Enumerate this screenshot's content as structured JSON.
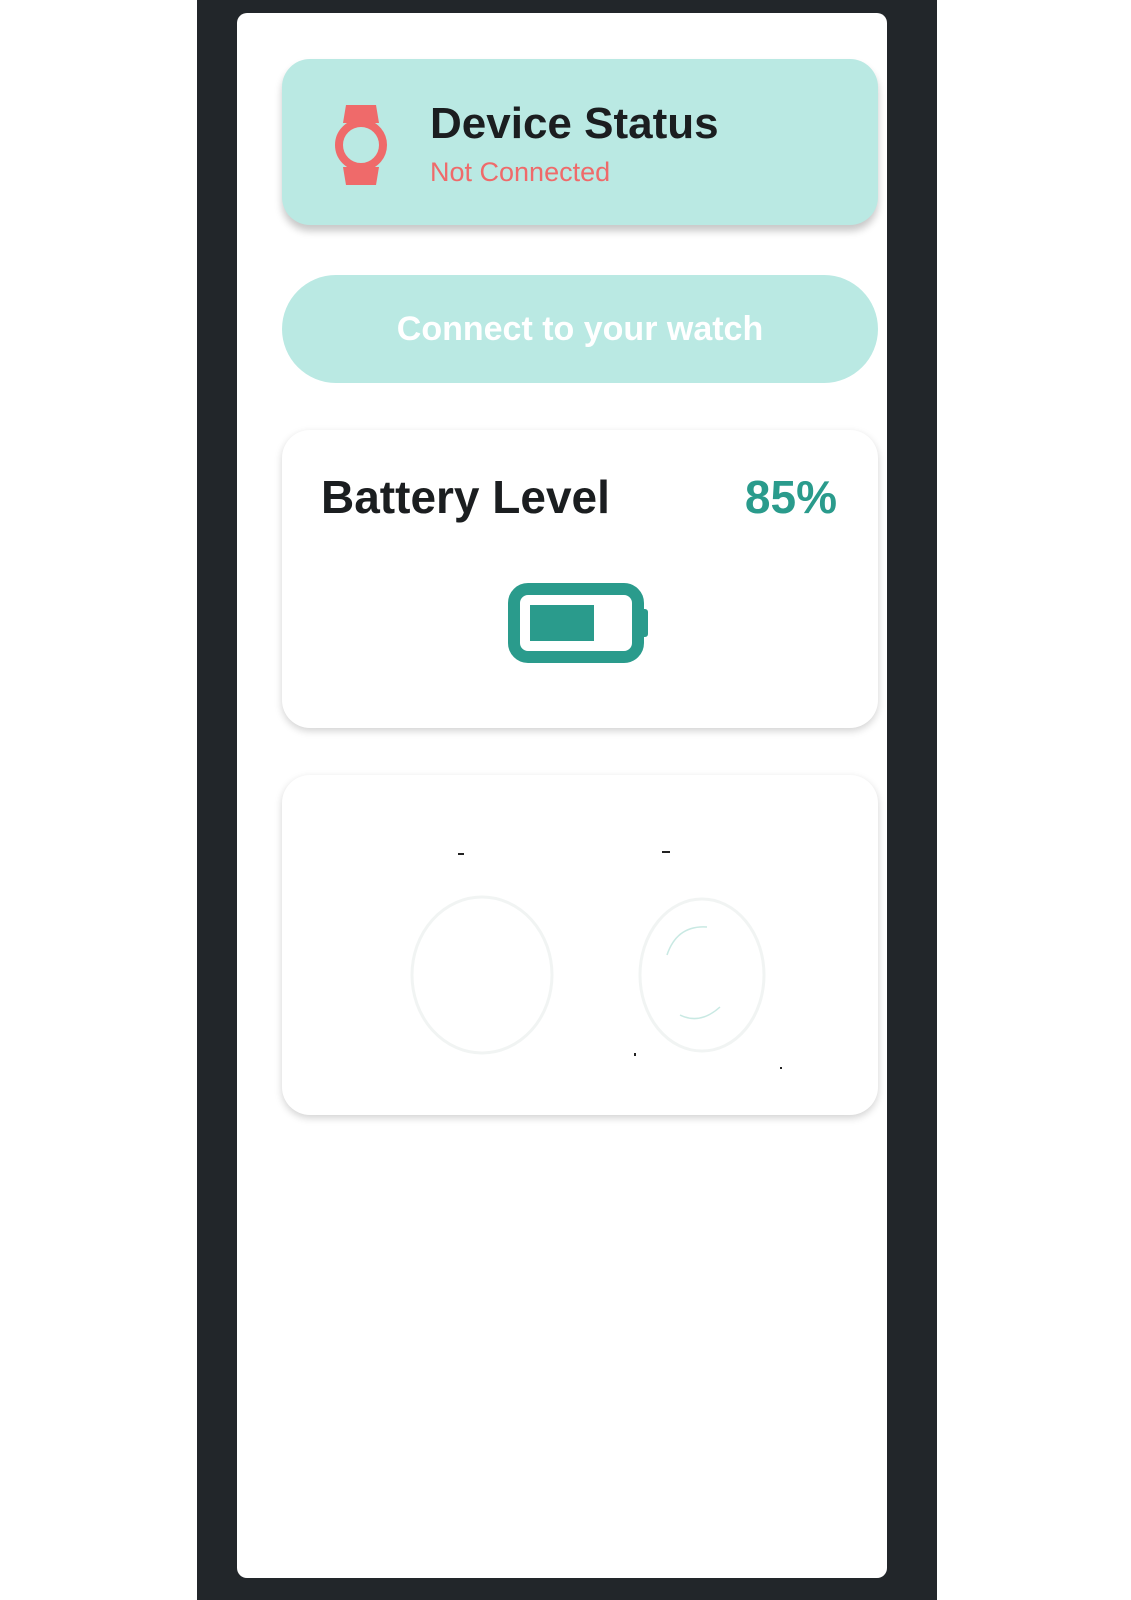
{
  "device_status": {
    "title": "Device Status",
    "status": "Not Connected",
    "icon": "watch-icon"
  },
  "connect_button": {
    "label": "Connect to your watch"
  },
  "battery": {
    "title": "Battery Level",
    "value": "85%",
    "level_percent": 85,
    "icon": "battery-icon"
  },
  "colors": {
    "card_bg": "#bae9e3",
    "accent": "#2a9b8c",
    "status_red": "#ef6a6a",
    "frame": "#22262a"
  }
}
